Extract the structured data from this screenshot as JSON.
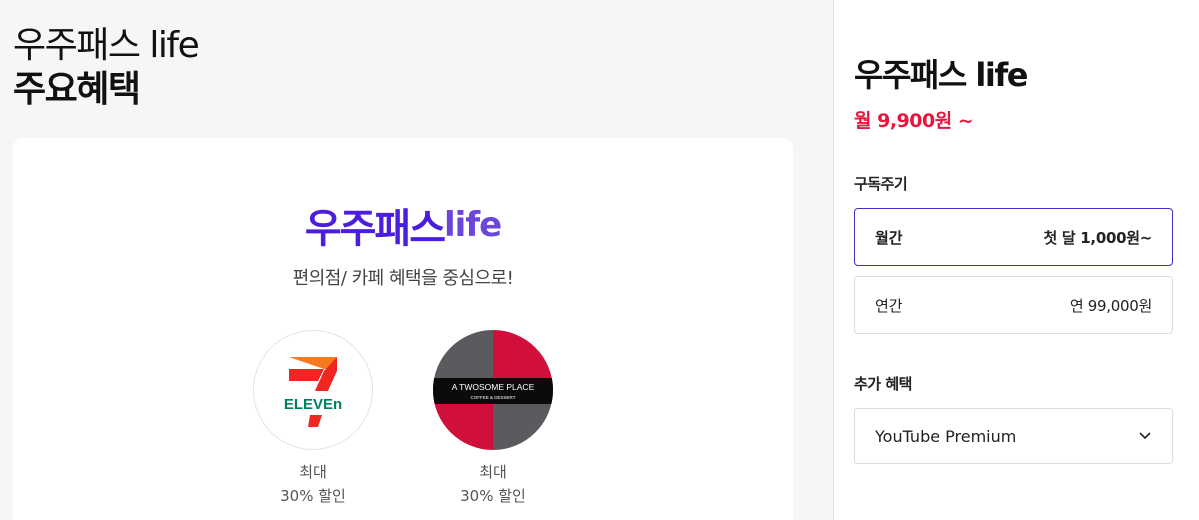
{
  "page": {
    "title_line1": "우주패스 life",
    "title_line2": "주요혜택"
  },
  "card": {
    "logo_korean": "우주패스",
    "logo_life": "life",
    "tagline": "편의점/ 카페 혜택을 중심으로!",
    "partners": [
      {
        "name": "7-ELEVEN",
        "logo_text": "ELEVEn",
        "caption1": "최대",
        "caption2": "30% 할인"
      },
      {
        "name": "A TWOSOME PLACE",
        "logo_text": "A TWOSOME PLACE",
        "logo_subtext": "COFFEE & DESSERT",
        "caption1": "최대",
        "caption2": "30% 할인"
      }
    ]
  },
  "sidebar": {
    "title": "우주패스 life",
    "price": "월 9,900원 ~",
    "cycle_label": "구독주기",
    "options": [
      {
        "label": "월간",
        "price": "첫 달 1,000원~",
        "selected": true
      },
      {
        "label": "연간",
        "price": "연 99,000원",
        "selected": false
      }
    ],
    "extra_label": "추가 혜택",
    "extra_selected": "YouTube Premium"
  },
  "colors": {
    "brand_purple": "#4b1ddc",
    "price_red": "#e8163c",
    "seven_orange": "#f47b20",
    "seven_green": "#008061",
    "seven_red": "#ee2723",
    "twosome_red": "#d0103a",
    "twosome_gray": "#5a5a5f"
  }
}
